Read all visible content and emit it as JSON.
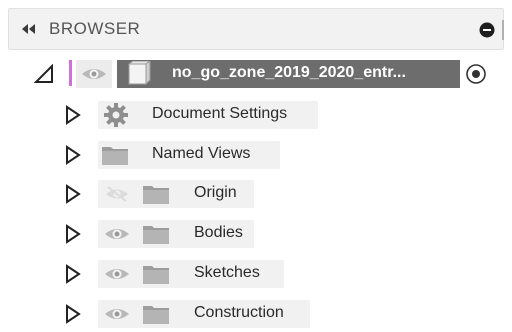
{
  "header": {
    "title": "BROWSER"
  },
  "root": {
    "label": "no_go_zone_2019_2020_entr..."
  },
  "items": [
    {
      "label": "Document Settings",
      "icon": "gear-icon"
    },
    {
      "label": "Named Views",
      "icon": "folder-icon"
    },
    {
      "label": "Origin",
      "icon": "folder-icon",
      "visibility": "hidden"
    },
    {
      "label": "Bodies",
      "icon": "folder-icon",
      "visibility": "visible"
    },
    {
      "label": "Sketches",
      "icon": "folder-icon",
      "visibility": "visible"
    },
    {
      "label": "Construction",
      "icon": "folder-icon",
      "visibility": "visible"
    }
  ],
  "colors": {
    "header_bg": "#f2f2f2",
    "root_bar": "#d06fd6",
    "root_selected_bg": "#6d6d6d",
    "chip_bg": "#f1f1f1"
  }
}
